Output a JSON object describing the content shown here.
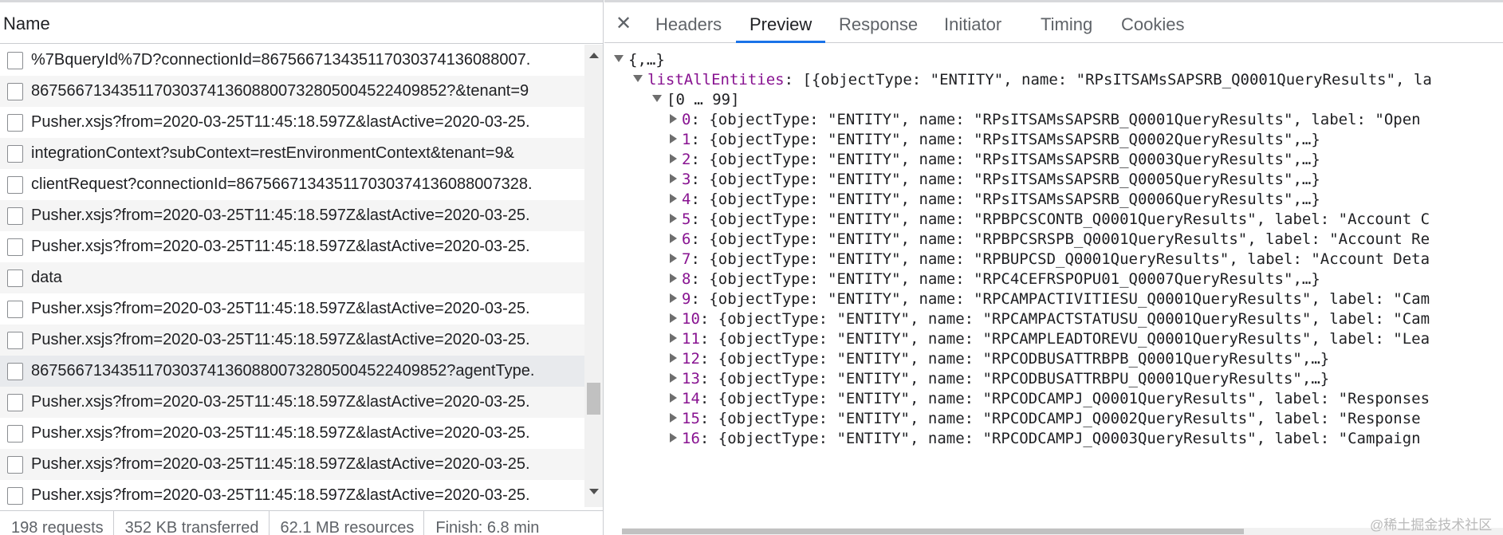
{
  "left": {
    "header": "Name",
    "requests": [
      "%7BqueryId%7D?connectionId=867566713435117030374136088007.",
      "86756671343511703037413608800732805004522409852?&tenant=9",
      "Pusher.xsjs?from=2020-03-25T11:45:18.597Z&lastActive=2020-03-25.",
      "integrationContext?subContext=restEnvironmentContext&tenant=9&",
      "clientRequest?connectionId=867566713435117030374136088007328.",
      "Pusher.xsjs?from=2020-03-25T11:45:18.597Z&lastActive=2020-03-25.",
      "Pusher.xsjs?from=2020-03-25T11:45:18.597Z&lastActive=2020-03-25.",
      "data",
      "Pusher.xsjs?from=2020-03-25T11:45:18.597Z&lastActive=2020-03-25.",
      "Pusher.xsjs?from=2020-03-25T11:45:18.597Z&lastActive=2020-03-25.",
      "86756671343511703037413608800732805004522409852?agentType.",
      "Pusher.xsjs?from=2020-03-25T11:45:18.597Z&lastActive=2020-03-25.",
      "Pusher.xsjs?from=2020-03-25T11:45:18.597Z&lastActive=2020-03-25.",
      "Pusher.xsjs?from=2020-03-25T11:45:18.597Z&lastActive=2020-03-25.",
      "Pusher.xsjs?from=2020-03-25T11:45:18.597Z&lastActive=2020-03-25."
    ],
    "status": [
      "198 requests",
      "352 KB transferred",
      "62.1 MB resources",
      "Finish: 6.8 min"
    ]
  },
  "right": {
    "close_icon": "✕",
    "tabs": [
      "Headers",
      "Preview",
      "Response",
      "Initiator",
      "Timing",
      "Cookies"
    ],
    "active_tab": "Preview",
    "tree": {
      "root": "{,…}",
      "list_key": "listAllEntities",
      "list_summary": "[{objectType: \"ENTITY\", name: \"RPsITSAMsSAPSRB_Q0001QueryResults\", la",
      "range": "[0 … 99]",
      "items": [
        {
          "index": "0",
          "content": "{objectType: \"ENTITY\", name: \"RPsITSAMsSAPSRB_Q0001QueryResults\", label: \"Open"
        },
        {
          "index": "1",
          "content": "{objectType: \"ENTITY\", name: \"RPsITSAMsSAPSRB_Q0002QueryResults\",…}"
        },
        {
          "index": "2",
          "content": "{objectType: \"ENTITY\", name: \"RPsITSAMsSAPSRB_Q0003QueryResults\",…}"
        },
        {
          "index": "3",
          "content": "{objectType: \"ENTITY\", name: \"RPsITSAMsSAPSRB_Q0005QueryResults\",…}"
        },
        {
          "index": "4",
          "content": "{objectType: \"ENTITY\", name: \"RPsITSAMsSAPSRB_Q0006QueryResults\",…}"
        },
        {
          "index": "5",
          "content": "{objectType: \"ENTITY\", name: \"RPBPCSCONTB_Q0001QueryResults\", label: \"Account C"
        },
        {
          "index": "6",
          "content": "{objectType: \"ENTITY\", name: \"RPBPCSRSPB_Q0001QueryResults\", label: \"Account Re"
        },
        {
          "index": "7",
          "content": "{objectType: \"ENTITY\", name: \"RPBUPCSD_Q0001QueryResults\", label: \"Account Deta"
        },
        {
          "index": "8",
          "content": "{objectType: \"ENTITY\", name: \"RPC4CEFRSPOPU01_Q0007QueryResults\",…}"
        },
        {
          "index": "9",
          "content": "{objectType: \"ENTITY\", name: \"RPCAMPACTIVITIESU_Q0001QueryResults\", label: \"Cam"
        },
        {
          "index": "10",
          "content": "{objectType: \"ENTITY\", name: \"RPCAMPACTSTATUSU_Q0001QueryResults\", label: \"Cam"
        },
        {
          "index": "11",
          "content": "{objectType: \"ENTITY\", name: \"RPCAMPLEADTOREVU_Q0001QueryResults\", label: \"Lea"
        },
        {
          "index": "12",
          "content": "{objectType: \"ENTITY\", name: \"RPCODBUSATTRBPB_Q0001QueryResults\",…}"
        },
        {
          "index": "13",
          "content": "{objectType: \"ENTITY\", name: \"RPCODBUSATTRBPU_Q0001QueryResults\",…}"
        },
        {
          "index": "14",
          "content": "{objectType: \"ENTITY\", name: \"RPCODCAMPJ_Q0001QueryResults\", label: \"Responses"
        },
        {
          "index": "15",
          "content": "{objectType: \"ENTITY\", name: \"RPCODCAMPJ_Q0002QueryResults\", label: \"Response"
        },
        {
          "index": "16",
          "content": "{objectType: \"ENTITY\", name: \"RPCODCAMPJ_Q0003QueryResults\", label: \"Campaign"
        }
      ]
    }
  },
  "watermark": "@稀土掘金技术社区"
}
